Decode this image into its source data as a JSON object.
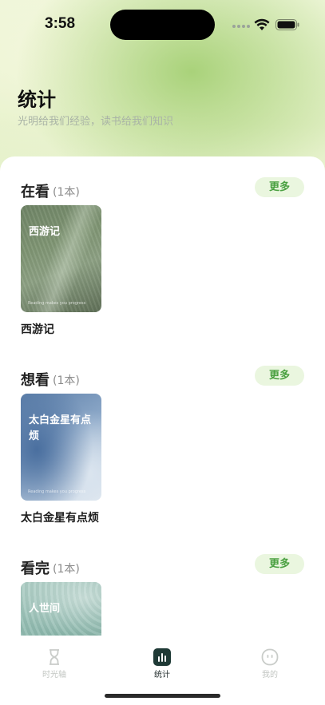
{
  "status_bar": {
    "time": "3:58"
  },
  "header": {
    "title": "统计",
    "subtitle": "光明给我们经验，读书给我们知识"
  },
  "sections": [
    {
      "title": "在看",
      "count": "(1本)",
      "more_label": "更多",
      "books": [
        {
          "cover_title": "西游记",
          "cover_tag": "Reading makes you progress",
          "name": "西游记"
        }
      ]
    },
    {
      "title": "想看",
      "count": "(1本)",
      "more_label": "更多",
      "books": [
        {
          "cover_title": "太白金星有点烦",
          "cover_tag": "Reading makes you progress",
          "name": "太白金星有点烦"
        }
      ]
    },
    {
      "title": "看完",
      "count": "(1本)",
      "more_label": "更多",
      "books": [
        {
          "cover_title": "人世间",
          "cover_tag": "",
          "name": ""
        }
      ]
    }
  ],
  "tab_bar": {
    "tabs": [
      {
        "label": "时光轴",
        "icon": "hourglass-icon",
        "active": false
      },
      {
        "label": "统计",
        "icon": "bar-chart-icon",
        "active": true
      },
      {
        "label": "我的",
        "icon": "profile-face-icon",
        "active": false
      }
    ]
  },
  "colors": {
    "accent_green": "#4aa041",
    "more_button_bg": "#eaf6df",
    "tab_active_bg": "#1f3a36"
  }
}
